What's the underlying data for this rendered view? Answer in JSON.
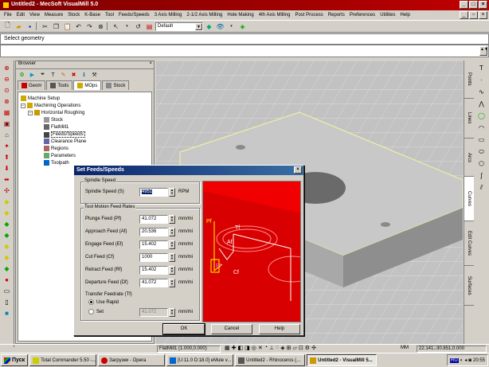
{
  "window": {
    "title": "Untitled2 - MecSoft VisualMill 5.0"
  },
  "menu": [
    "File",
    "Edit",
    "View",
    "Measure",
    "Stock",
    "K-Base",
    "Tool",
    "Feeds/Speeds",
    "3 Axis Milling",
    "2-1/2 Axis Milling",
    "Hole Making",
    "4th Axis Milling",
    "Post Process",
    "Reports",
    "Preferences",
    "Utilities",
    "Help"
  ],
  "toolbar": {
    "view_combo": "Default"
  },
  "prompt": {
    "text": "Select geometry"
  },
  "browser": {
    "title": "Browser",
    "tabs": [
      "Geom",
      "Tools",
      "MOps",
      "Stock"
    ],
    "tree": [
      {
        "label": "Machine Setup"
      },
      {
        "label": "Machining Operations"
      },
      {
        "label": "Horizontal Roughing"
      },
      {
        "label": "Stock"
      },
      {
        "label": "FlatMill1"
      },
      {
        "label": "Feeds/Speeds"
      },
      {
        "label": "Clearance Plane"
      },
      {
        "label": "Regions"
      },
      {
        "label": "Parameters"
      },
      {
        "label": "Toolpath"
      }
    ]
  },
  "right_tabs": [
    "Points",
    "Lines",
    "Arcs",
    "Curves",
    "Edit Curves",
    "Surfaces"
  ],
  "dialog": {
    "title": "Set Feeds/Speeds",
    "spindle_group": "Spindle Speed",
    "spindle_label": "Spindle Speed (S)",
    "spindle_value": "4951",
    "spindle_unit": "RPM",
    "feed_group": "Tool Motion Feed Rates",
    "feeds": [
      {
        "label": "Plunge Feed (Pf)",
        "value": "41.072",
        "unit": "mm/mi"
      },
      {
        "label": "Approach Feed (Af)",
        "value": "20.536",
        "unit": "mm/mi"
      },
      {
        "label": "Engage Feed (Ef)",
        "value": "15.402",
        "unit": "mm/mi"
      },
      {
        "label": "Cut Feed (Cf)",
        "value": "1000",
        "unit": "mm/mi"
      },
      {
        "label": "Retract Feed (Rf)",
        "value": "15.402",
        "unit": "mm/mi"
      },
      {
        "label": "Departure Feed (Df)",
        "value": "41.072",
        "unit": "mm/mi"
      }
    ],
    "transfer_label": "Transfer Feedrate (Tf)",
    "use_rapid": "Use Rapid",
    "set_label": "Set",
    "set_value": "41.072",
    "set_unit": "mm/mi",
    "ok": "OK",
    "cancel": "Cancel",
    "help": "Help",
    "preview_labels": {
      "pf": "Pf",
      "tf": "Tf",
      "af": "Af",
      "ef": "Ef",
      "cf": "Cf"
    }
  },
  "status": {
    "geometry": "FlatMill1 (1.000,0.000)",
    "units": "MM",
    "coords": "22.141,-30.851,0.000"
  },
  "taskbar": {
    "start": "Пуск",
    "tasks": [
      "Total Commander 5.50 -...",
      "Загрузки - Opera",
      "[U:11.0 D:18.0] eMule v...",
      "Untitled2 - Rhinoceros (...",
      "Untitled2 - VisualMill 5..."
    ],
    "lang": "RU",
    "clock": "20:55"
  }
}
